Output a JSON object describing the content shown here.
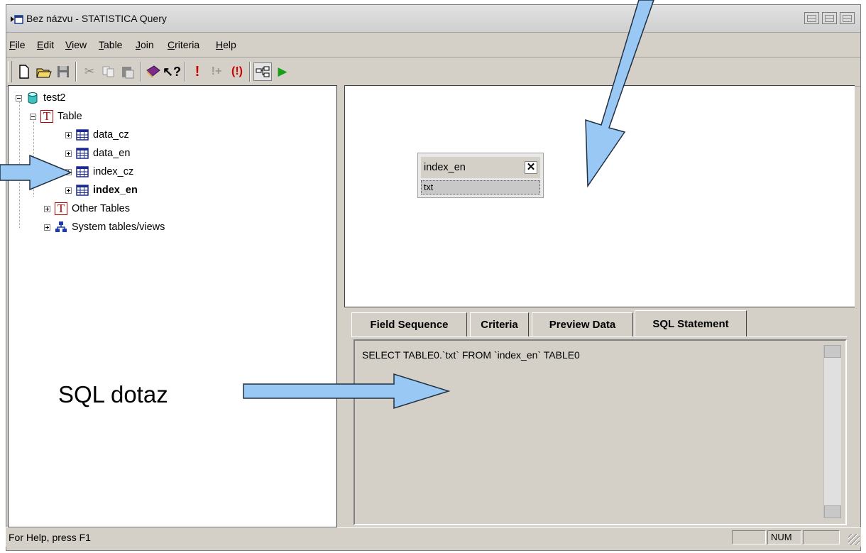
{
  "window": {
    "title": "Bez názvu - STATISTICA Query"
  },
  "menu": [
    {
      "label": "File"
    },
    {
      "label": "Edit"
    },
    {
      "label": "View"
    },
    {
      "label": "Table"
    },
    {
      "label": "Join"
    },
    {
      "label": "Criteria"
    },
    {
      "label": "Help"
    }
  ],
  "toolbar": {
    "icons": [
      "new-file-icon",
      "open-folder-icon",
      "save-icon",
      "cut-icon",
      "copy-icon",
      "paste-icon",
      "book-icon",
      "help-pointer-icon",
      "run-query-icon",
      "run-step-icon",
      "run-all-icon",
      "join-icon",
      "play-icon"
    ]
  },
  "tree": {
    "root": "test2",
    "table_group": "Table",
    "tables": [
      "data_cz",
      "data_en",
      "index_cz",
      "index_en"
    ],
    "other_tables": "Other Tables",
    "system_tables": "System tables/views"
  },
  "diagram": {
    "table_name": "index_en",
    "close": "✕",
    "field": "txt"
  },
  "tabs": [
    {
      "label": "Field Sequence"
    },
    {
      "label": "Criteria"
    },
    {
      "label": "Preview Data"
    },
    {
      "label": "SQL Statement"
    }
  ],
  "sql": {
    "statement": "SELECT TABLE0.`txt` FROM `index_en` TABLE0"
  },
  "status": {
    "help": "For Help, press F1",
    "num": "NUM"
  },
  "annotation": {
    "label": "SQL dotaz"
  }
}
